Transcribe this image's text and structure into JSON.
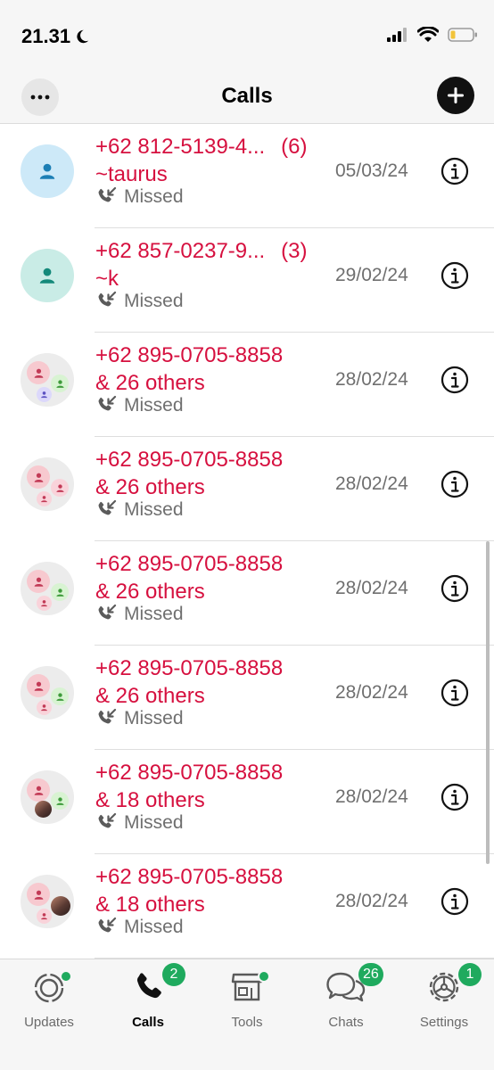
{
  "status_bar": {
    "time": "21.31"
  },
  "header": {
    "title": "Calls"
  },
  "calls": [
    {
      "number": "+62 812-5139-4...",
      "count": "(6)",
      "second_line": "~taurus",
      "status": "Missed",
      "date": "05/03/24",
      "avatar": "single-blue"
    },
    {
      "number": "+62 857-0237-9...",
      "count": "(3)",
      "second_line": "~k",
      "status": "Missed",
      "date": "29/02/24",
      "avatar": "single-teal"
    },
    {
      "number": "+62 895-0705-8858",
      "count": "",
      "second_line": "& 26 others",
      "status": "Missed",
      "date": "28/02/24",
      "avatar": "group"
    },
    {
      "number": "+62 895-0705-8858",
      "count": "",
      "second_line": "& 26 others",
      "status": "Missed",
      "date": "28/02/24",
      "avatar": "group"
    },
    {
      "number": "+62 895-0705-8858",
      "count": "",
      "second_line": "& 26 others",
      "status": "Missed",
      "date": "28/02/24",
      "avatar": "group"
    },
    {
      "number": "+62 895-0705-8858",
      "count": "",
      "second_line": "& 26 others",
      "status": "Missed",
      "date": "28/02/24",
      "avatar": "group"
    },
    {
      "number": "+62 895-0705-8858",
      "count": "",
      "second_line": "& 18 others",
      "status": "Missed",
      "date": "28/02/24",
      "avatar": "group-photo"
    },
    {
      "number": "+62 895-0705-8858",
      "count": "",
      "second_line": "& 18 others",
      "status": "Missed",
      "date": "28/02/24",
      "avatar": "group-photo"
    }
  ],
  "tabs": [
    {
      "label": "Updates",
      "icon": "updates-icon",
      "badge": "",
      "dot": true,
      "active": false
    },
    {
      "label": "Calls",
      "icon": "phone-icon",
      "badge": "2",
      "dot": false,
      "active": true
    },
    {
      "label": "Tools",
      "icon": "storefront-icon",
      "badge": "",
      "dot": true,
      "active": false
    },
    {
      "label": "Chats",
      "icon": "chat-bubbles-icon",
      "badge": "26",
      "dot": false,
      "active": false
    },
    {
      "label": "Settings",
      "icon": "gear-icon",
      "badge": "1",
      "dot": false,
      "active": false
    }
  ],
  "colors": {
    "missed_red": "#d6103f",
    "badge_green": "#1faa5e",
    "secondary_text": "#6f6f6f"
  }
}
